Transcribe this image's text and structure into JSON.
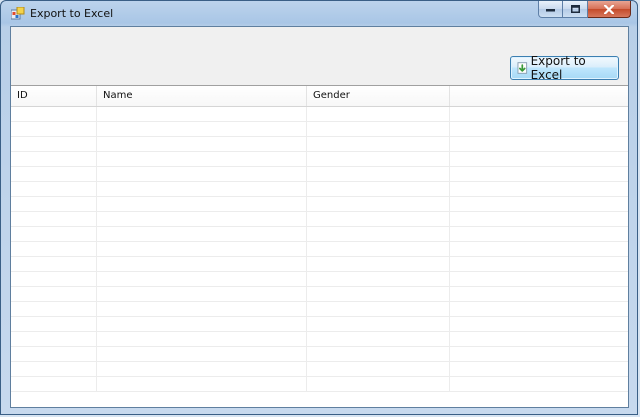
{
  "window": {
    "title": "Export to Excel"
  },
  "toolbar": {
    "export_label": "Export to Excel",
    "export_icon": "excel-export-icon"
  },
  "grid": {
    "columns": [
      "ID",
      "Name",
      "Gender",
      ""
    ],
    "row_count": 19
  },
  "colors": {
    "accent": "#3c7fb1",
    "close": "#c44a2a"
  }
}
